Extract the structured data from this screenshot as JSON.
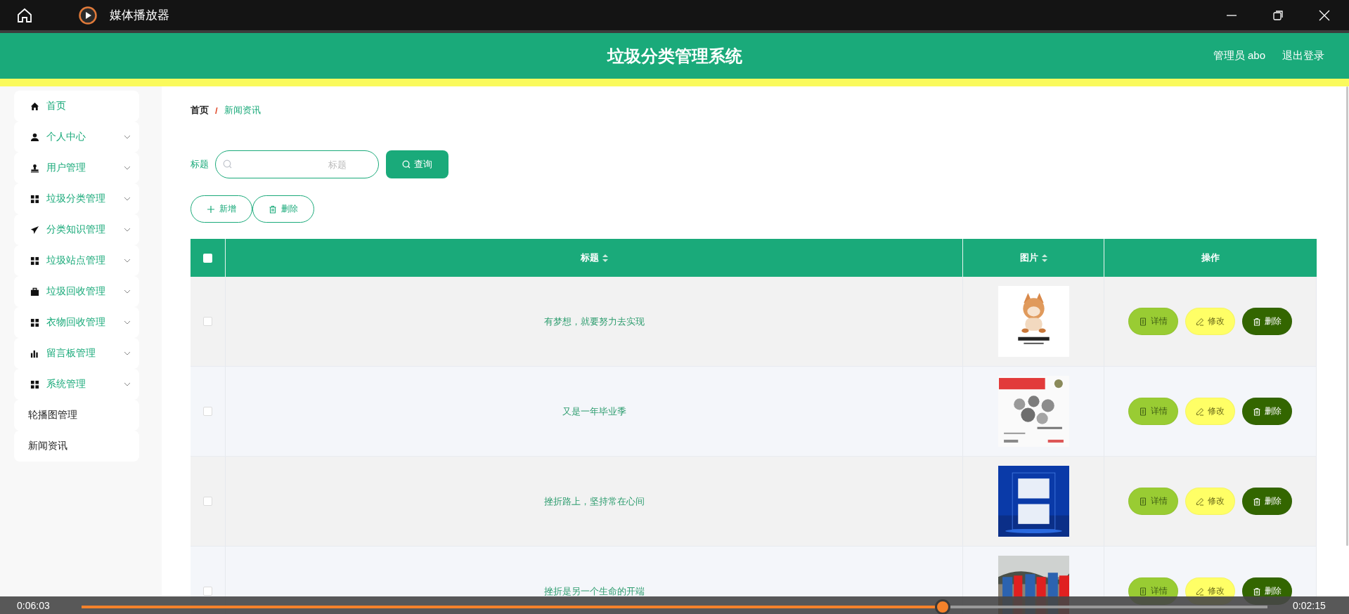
{
  "player": {
    "title": "媒体播放器",
    "elapsed": "0:06:03",
    "remaining": "0:02:15",
    "level": 0.726
  },
  "app": {
    "title": "垃圾分类管理系统",
    "user": "管理员 abo",
    "logout": "退出登录"
  },
  "sidebar": {
    "items": [
      {
        "label": "首页",
        "kind": "home",
        "expandable": false
      },
      {
        "label": "个人中心",
        "kind": "person",
        "expandable": true
      },
      {
        "label": "用户管理",
        "kind": "stamp",
        "expandable": true
      },
      {
        "label": "垃圾分类管理",
        "kind": "grid",
        "expandable": true
      },
      {
        "label": "分类知识管理",
        "kind": "plane",
        "expandable": true
      },
      {
        "label": "垃圾站点管理",
        "kind": "grid",
        "expandable": true
      },
      {
        "label": "垃圾回收管理",
        "kind": "briefcase",
        "expandable": true
      },
      {
        "label": "衣物回收管理",
        "kind": "grid",
        "expandable": true
      },
      {
        "label": "留言板管理",
        "kind": "bars",
        "expandable": true
      },
      {
        "label": "系统管理",
        "kind": "grid",
        "expandable": true,
        "children": [
          {
            "label": "轮播图管理"
          },
          {
            "label": "新闻资讯"
          }
        ]
      }
    ]
  },
  "breadcrumb": {
    "items": [
      "首页",
      "新闻资讯"
    ],
    "separator": "/"
  },
  "search": {
    "label": "标题",
    "placeholder": "标题",
    "button": "查询"
  },
  "actions": [
    {
      "label": "新增",
      "kind": "add"
    },
    {
      "label": "删除",
      "kind": "delete"
    }
  ],
  "table": {
    "all_checked": false,
    "columns": [
      {
        "label": "标题",
        "sortable": true
      },
      {
        "label": "图片",
        "sortable": true
      },
      {
        "label": "操作",
        "sortable": false
      }
    ],
    "rows": [
      {
        "checked": false,
        "title": "有梦想，就要努力去实现",
        "picture": {
          "kind": "picture"
        },
        "buttons": [
          {
            "label": "详情",
            "kind": "detail"
          },
          {
            "label": "修改",
            "kind": "edit"
          },
          {
            "label": "删除",
            "kind": "delete"
          }
        ]
      },
      {
        "checked": false,
        "title": "又是一年毕业季",
        "picture": {
          "kind": "picture"
        },
        "buttons": [
          {
            "label": "详情",
            "kind": "detail"
          },
          {
            "label": "修改",
            "kind": "edit"
          },
          {
            "label": "删除",
            "kind": "delete"
          }
        ]
      },
      {
        "checked": false,
        "title": "挫折路上，坚持常在心间",
        "picture": {
          "kind": "picture"
        },
        "buttons": [
          {
            "label": "详情",
            "kind": "detail"
          },
          {
            "label": "修改",
            "kind": "edit"
          },
          {
            "label": "删除",
            "kind": "delete"
          }
        ]
      },
      {
        "checked": false,
        "title": "挫折是另一个生命的开端",
        "picture": {
          "kind": "picture"
        },
        "buttons": [
          {
            "label": "详情",
            "kind": "detail"
          },
          {
            "label": "修改",
            "kind": "edit"
          },
          {
            "label": "删除",
            "kind": "delete"
          }
        ]
      }
    ]
  }
}
